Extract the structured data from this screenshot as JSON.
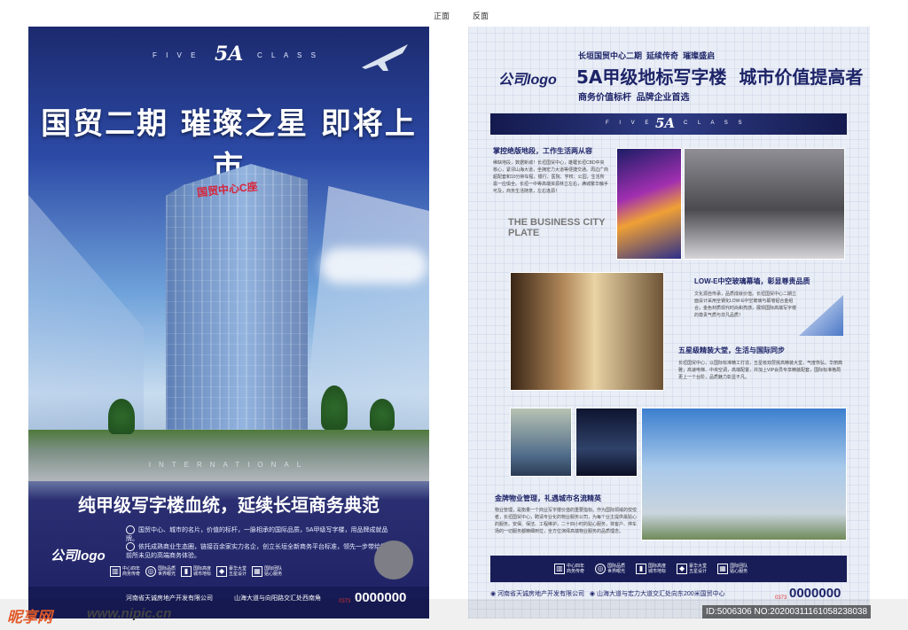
{
  "labels": {
    "front": "正面",
    "back": "反面"
  },
  "front": {
    "brand_left": "F I V E",
    "brand_mid": "5A",
    "brand_right": "C L A S S",
    "headline": "国贸二期  璀璨之星  即将上市",
    "tower_sign": "国贸中心C座",
    "international": "INTERNATIONAL",
    "slogan": "纯甲级写字楼血统，延续长垣商务典范",
    "bullets": [
      "国贸中心、城市的名片，价值的标杆，一脉相承的国际品质，5A甲级写字楼，用品牌成就品牌。",
      "依托成熟商业生态圈，链接百余家实力名企，创立长垣全新商务平台标准，领先一步带给您前所未见的高端商务体验。"
    ],
    "logo": "公司logo",
    "icons": [
      {
        "icon": "building-icon",
        "lines": [
          "中心四年",
          "商务传奇"
        ]
      },
      {
        "icon": "globe-icon",
        "lines": [
          "国际品质",
          "世界眼光"
        ]
      },
      {
        "icon": "bars-icon",
        "lines": [
          "国际高度",
          "城市地标"
        ]
      },
      {
        "icon": "diamond-icon",
        "lines": [
          "豪华大堂",
          "五星设计"
        ]
      },
      {
        "icon": "grid-icon",
        "lines": [
          "国际团队",
          "贴心服务"
        ]
      }
    ],
    "developer": "河南省天诚房地产开发有限公司",
    "address": "山海大道与向阳路交汇处西南角",
    "phone_prefix": "0373",
    "phone": "0000000"
  },
  "back": {
    "logo": "公司logo",
    "tag1": "长垣国贸中心二期",
    "tag2": "延续传奇",
    "tag3": "璀璨盛启",
    "headline_a": "5A甲级地标写字楼",
    "headline_b": "城市价值提高者",
    "sub1": "商务价值标杆",
    "sub2": "品牌企业首选",
    "band_left": "F I V E",
    "band_mid": "5A",
    "band_right": "C L A S S",
    "sections": [
      {
        "title": "掌控绝版地段，工作生活两从容",
        "text": "稀缺地段，数据新城！长垣国贸中心，雄踞长垣CBD中央核心，紧邻山海大道，坐拥宏力大道等便捷交通。周边广商超配套和10分钟车程，银行、医院、学校、公园，生活所需一应俱全。长垣一中等高端资源林立左右，满城繁华触手可及，商务生活随意，左右逢源！"
      },
      {
        "title": "LOW-E中空玻璃幕墙，彰显尊贵品质",
        "text": "文化源自传承，品质成就价值。长垣国贸中心二期立面设计采用全钢化LOW-E中空玻璃与幕墙铝合金组合，金色材质现代时尚和亮感，展现国际高端写字楼的尊贵气质与非凡品质！"
      },
      {
        "title": "五星级精装大堂，生活与国际同步",
        "text": "长垣国贸中心，以国际标准精工打造，五星级双层挑高精装大堂，气度恢弘，华丽典雅；高速电梯、中央空调，高端配置，并加上VIP会员专享精装配套，国际标准格局更上一个台阶，品质魅力彰显不凡。"
      },
      {
        "title": "金牌物业管理，礼遇城市名流精英",
        "text": "物业管理，是衡量一个商业写字楼价值的重要指标。作为国际领域的佼佼者，长垣国贸中心，聘请专业化的物业服务公司，为每个业主提供最贴心的服务。安保、保洁、工程维护，二十四小时的贴心服务，将客户、停车场的一切服务都精细到位，全方位演绎高端物业服务的品质理念。"
      }
    ],
    "photo_text": "THE BUSINESS CITY PLATE",
    "icons": [
      {
        "icon": "building-icon",
        "lines": [
          "中心四年",
          "商务传奇"
        ]
      },
      {
        "icon": "globe-icon",
        "lines": [
          "国际品质",
          "世界眼光"
        ]
      },
      {
        "icon": "bars-icon",
        "lines": [
          "国际高度",
          "城市地标"
        ]
      },
      {
        "icon": "diamond-icon",
        "lines": [
          "豪华大堂",
          "五星设计"
        ]
      },
      {
        "icon": "grid-icon",
        "lines": [
          "国际团队",
          "贴心服务"
        ]
      }
    ],
    "developer": "河南省天诚房地产开发有限公司",
    "address": "山海大道与宏力大道交汇处向东200米国贸中心",
    "phone_prefix": "0373",
    "phone": "0000000"
  },
  "watermark": {
    "logo": "昵享网",
    "url": "www.nipic.cn",
    "id": "ID:5006306 NO:20200311161058238038"
  }
}
